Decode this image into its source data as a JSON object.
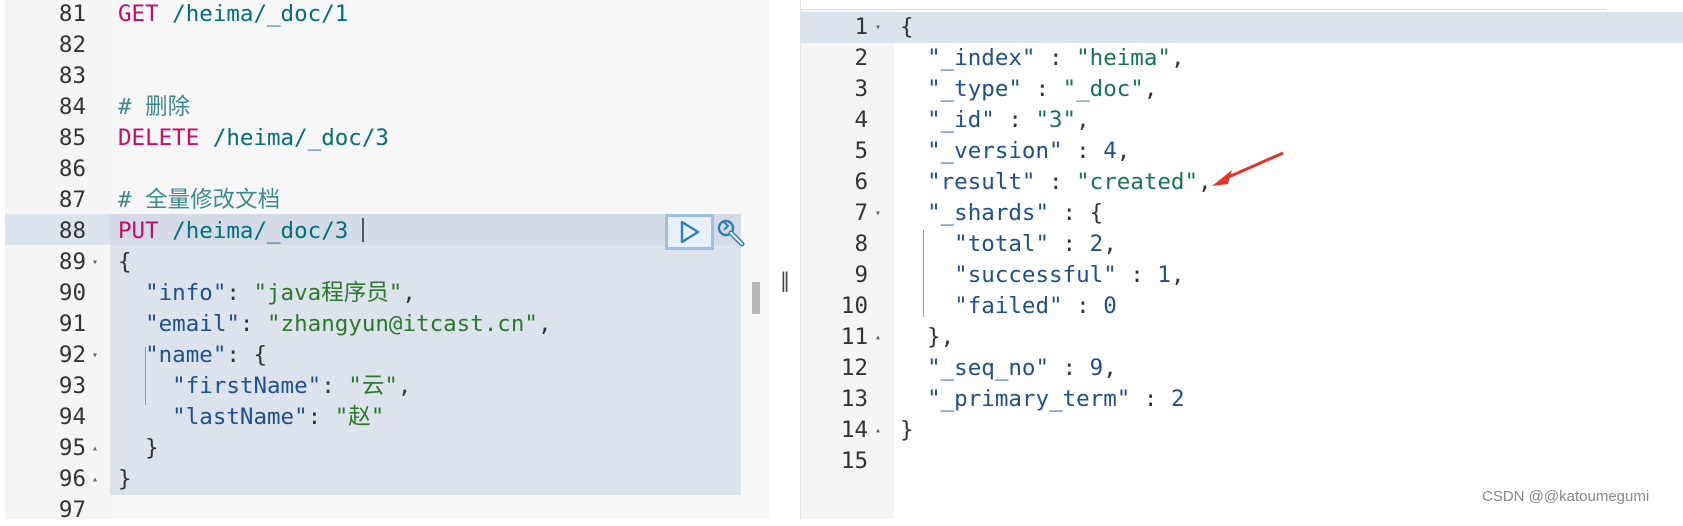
{
  "request_editor": {
    "lines": [
      {
        "n": "81",
        "segs": [
          {
            "t": "GET",
            "c": "kw-red"
          },
          {
            "t": " /heima/_doc/1",
            "c": "path"
          }
        ]
      },
      {
        "n": "82",
        "segs": []
      },
      {
        "n": "83",
        "segs": []
      },
      {
        "n": "84",
        "segs": [
          {
            "t": "# 删除",
            "c": "cmt"
          }
        ]
      },
      {
        "n": "85",
        "segs": [
          {
            "t": "DELETE",
            "c": "kw-red"
          },
          {
            "t": " /heima/_doc/3",
            "c": "path"
          }
        ]
      },
      {
        "n": "86",
        "segs": []
      },
      {
        "n": "87",
        "segs": [
          {
            "t": "# 全量修改文档",
            "c": "cmt"
          }
        ]
      },
      {
        "n": "88",
        "segs": [
          {
            "t": "PUT",
            "c": "kw-red"
          },
          {
            "t": " /heima/_doc/3",
            "c": "path"
          }
        ]
      },
      {
        "n": "89",
        "fold": "▾",
        "segs": [
          {
            "t": "{",
            "c": "punc"
          }
        ]
      },
      {
        "n": "90",
        "segs": [
          {
            "t": "  \"info\"",
            "c": "key"
          },
          {
            "t": ": ",
            "c": "punc"
          },
          {
            "t": "\"java程序员\"",
            "c": "str"
          },
          {
            "t": ",",
            "c": "punc"
          }
        ]
      },
      {
        "n": "91",
        "segs": [
          {
            "t": "  \"email\"",
            "c": "key"
          },
          {
            "t": ": ",
            "c": "punc"
          },
          {
            "t": "\"zhangyun@itcast.cn\"",
            "c": "str"
          },
          {
            "t": ",",
            "c": "punc"
          }
        ]
      },
      {
        "n": "92",
        "fold": "▾",
        "segs": [
          {
            "t": "  \"name\"",
            "c": "key"
          },
          {
            "t": ": {",
            "c": "punc"
          }
        ]
      },
      {
        "n": "93",
        "segs": [
          {
            "t": "    \"firstName\"",
            "c": "key"
          },
          {
            "t": ": ",
            "c": "punc"
          },
          {
            "t": "\"云\"",
            "c": "str"
          },
          {
            "t": ",",
            "c": "punc"
          }
        ]
      },
      {
        "n": "94",
        "segs": [
          {
            "t": "    \"lastName\"",
            "c": "key"
          },
          {
            "t": ": ",
            "c": "punc"
          },
          {
            "t": "\"赵\"",
            "c": "str"
          }
        ]
      },
      {
        "n": "95",
        "fold": "▴",
        "segs": [
          {
            "t": "  }",
            "c": "punc"
          }
        ]
      },
      {
        "n": "96",
        "fold": "▴",
        "segs": [
          {
            "t": "}",
            "c": "punc"
          }
        ]
      },
      {
        "n": "97",
        "segs": []
      }
    ]
  },
  "response_viewer": {
    "lines": [
      {
        "n": "1",
        "fold": "▾",
        "segs": [
          {
            "t": "{",
            "c": "punc"
          }
        ]
      },
      {
        "n": "2",
        "segs": [
          {
            "t": "  \"_index\"",
            "c": "key"
          },
          {
            "t": " : ",
            "c": "punc"
          },
          {
            "t": "\"heima\"",
            "c": "rstr"
          },
          {
            "t": ",",
            "c": "punc"
          }
        ]
      },
      {
        "n": "3",
        "segs": [
          {
            "t": "  \"_type\"",
            "c": "key"
          },
          {
            "t": " : ",
            "c": "punc"
          },
          {
            "t": "\"_doc\"",
            "c": "rstr"
          },
          {
            "t": ",",
            "c": "punc"
          }
        ]
      },
      {
        "n": "4",
        "segs": [
          {
            "t": "  \"_id\"",
            "c": "key"
          },
          {
            "t": " : ",
            "c": "punc"
          },
          {
            "t": "\"3\"",
            "c": "rstr"
          },
          {
            "t": ",",
            "c": "punc"
          }
        ]
      },
      {
        "n": "5",
        "segs": [
          {
            "t": "  \"_version\"",
            "c": "key"
          },
          {
            "t": " : ",
            "c": "punc"
          },
          {
            "t": "4",
            "c": "num"
          },
          {
            "t": ",",
            "c": "punc"
          }
        ]
      },
      {
        "n": "6",
        "segs": [
          {
            "t": "  \"result\"",
            "c": "key"
          },
          {
            "t": " : ",
            "c": "punc"
          },
          {
            "t": "\"created\"",
            "c": "rstr"
          },
          {
            "t": ",",
            "c": "punc"
          }
        ]
      },
      {
        "n": "7",
        "fold": "▾",
        "segs": [
          {
            "t": "  \"_shards\"",
            "c": "key"
          },
          {
            "t": " : {",
            "c": "punc"
          }
        ]
      },
      {
        "n": "8",
        "segs": [
          {
            "t": "    \"total\"",
            "c": "key"
          },
          {
            "t": " : ",
            "c": "punc"
          },
          {
            "t": "2",
            "c": "num"
          },
          {
            "t": ",",
            "c": "punc"
          }
        ]
      },
      {
        "n": "9",
        "segs": [
          {
            "t": "    \"successful\"",
            "c": "key"
          },
          {
            "t": " : ",
            "c": "punc"
          },
          {
            "t": "1",
            "c": "num"
          },
          {
            "t": ",",
            "c": "punc"
          }
        ]
      },
      {
        "n": "10",
        "segs": [
          {
            "t": "    \"failed\"",
            "c": "key"
          },
          {
            "t": " : ",
            "c": "punc"
          },
          {
            "t": "0",
            "c": "num"
          }
        ]
      },
      {
        "n": "11",
        "fold": "▴",
        "segs": [
          {
            "t": "  },",
            "c": "punc"
          }
        ]
      },
      {
        "n": "12",
        "segs": [
          {
            "t": "  \"_seq_no\"",
            "c": "key"
          },
          {
            "t": " : ",
            "c": "punc"
          },
          {
            "t": "9",
            "c": "num"
          },
          {
            "t": ",",
            "c": "punc"
          }
        ]
      },
      {
        "n": "13",
        "segs": [
          {
            "t": "  \"_primary_term\"",
            "c": "key"
          },
          {
            "t": " : ",
            "c": "punc"
          },
          {
            "t": "2",
            "c": "num"
          }
        ]
      },
      {
        "n": "14",
        "fold": "▴",
        "segs": [
          {
            "t": "}",
            "c": "punc"
          }
        ]
      },
      {
        "n": "15",
        "segs": []
      }
    ]
  },
  "icons": {
    "run": "play-icon",
    "settings": "wrench-icon",
    "resize": "resize-handle-icon",
    "annotation": "red-arrow"
  },
  "colors": {
    "highlight": "#dde3ec",
    "gutter": "#f5f5f5",
    "method": "#c80a68",
    "annotation_arrow": "#e8302a"
  },
  "divider_glyph": "‖",
  "watermark": "CSDN @@katoumegumi"
}
